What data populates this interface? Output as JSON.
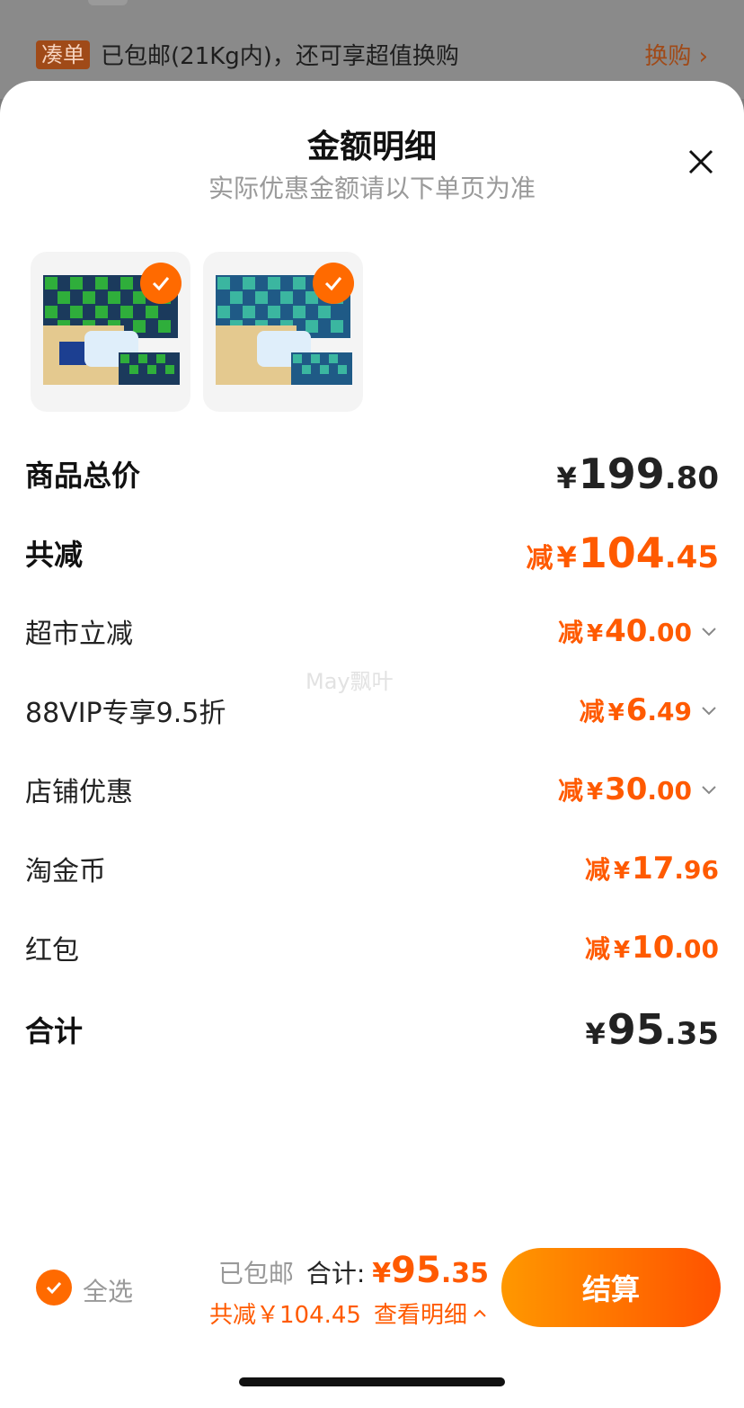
{
  "background": {
    "tag": "凑单",
    "text": "已包邮(21Kg内)，还可享超值换购",
    "link": "换购"
  },
  "sheet": {
    "title": "金额明细",
    "subtitle": "实际优惠金额请以下单页为准"
  },
  "products": [
    {
      "name": "product-thumb-1",
      "checked": true
    },
    {
      "name": "product-thumb-2",
      "checked": true
    }
  ],
  "rows": {
    "total_price": {
      "label": "商品总价",
      "currency": "¥",
      "int": "199",
      "dec": ".80"
    },
    "total_discount": {
      "label": "共减",
      "prefix": "减",
      "currency": "¥",
      "int": "104",
      "dec": ".45"
    },
    "supermarket": {
      "label": "超市立减",
      "prefix": "减",
      "currency": "¥",
      "int": "40",
      "dec": ".00"
    },
    "vip": {
      "label": "88VIP专享9.5折",
      "prefix": "减",
      "currency": "¥",
      "int": "6",
      "dec": ".49"
    },
    "store": {
      "label": "店铺优惠",
      "prefix": "减",
      "currency": "¥",
      "int": "30",
      "dec": ".00"
    },
    "coins": {
      "label": "淘金币",
      "prefix": "减",
      "currency": "¥",
      "int": "17",
      "dec": ".96"
    },
    "redpacket": {
      "label": "红包",
      "prefix": "减",
      "currency": "¥",
      "int": "10",
      "dec": ".00"
    },
    "sum": {
      "label": "合计",
      "currency": "¥",
      "int": "95",
      "dec": ".35"
    }
  },
  "watermark": "May飘叶",
  "footer": {
    "select_all": "全选",
    "shipping": "已包邮",
    "total_label": "合计:",
    "currency": "¥",
    "int": "95",
    "dec": ".35",
    "discount_text": "共减￥104.45",
    "detail_link": "查看明细",
    "pay_button": "结算"
  },
  "colors": {
    "accent": "#ff5a00",
    "button_start": "#ff9800",
    "button_end": "#ff5200"
  }
}
